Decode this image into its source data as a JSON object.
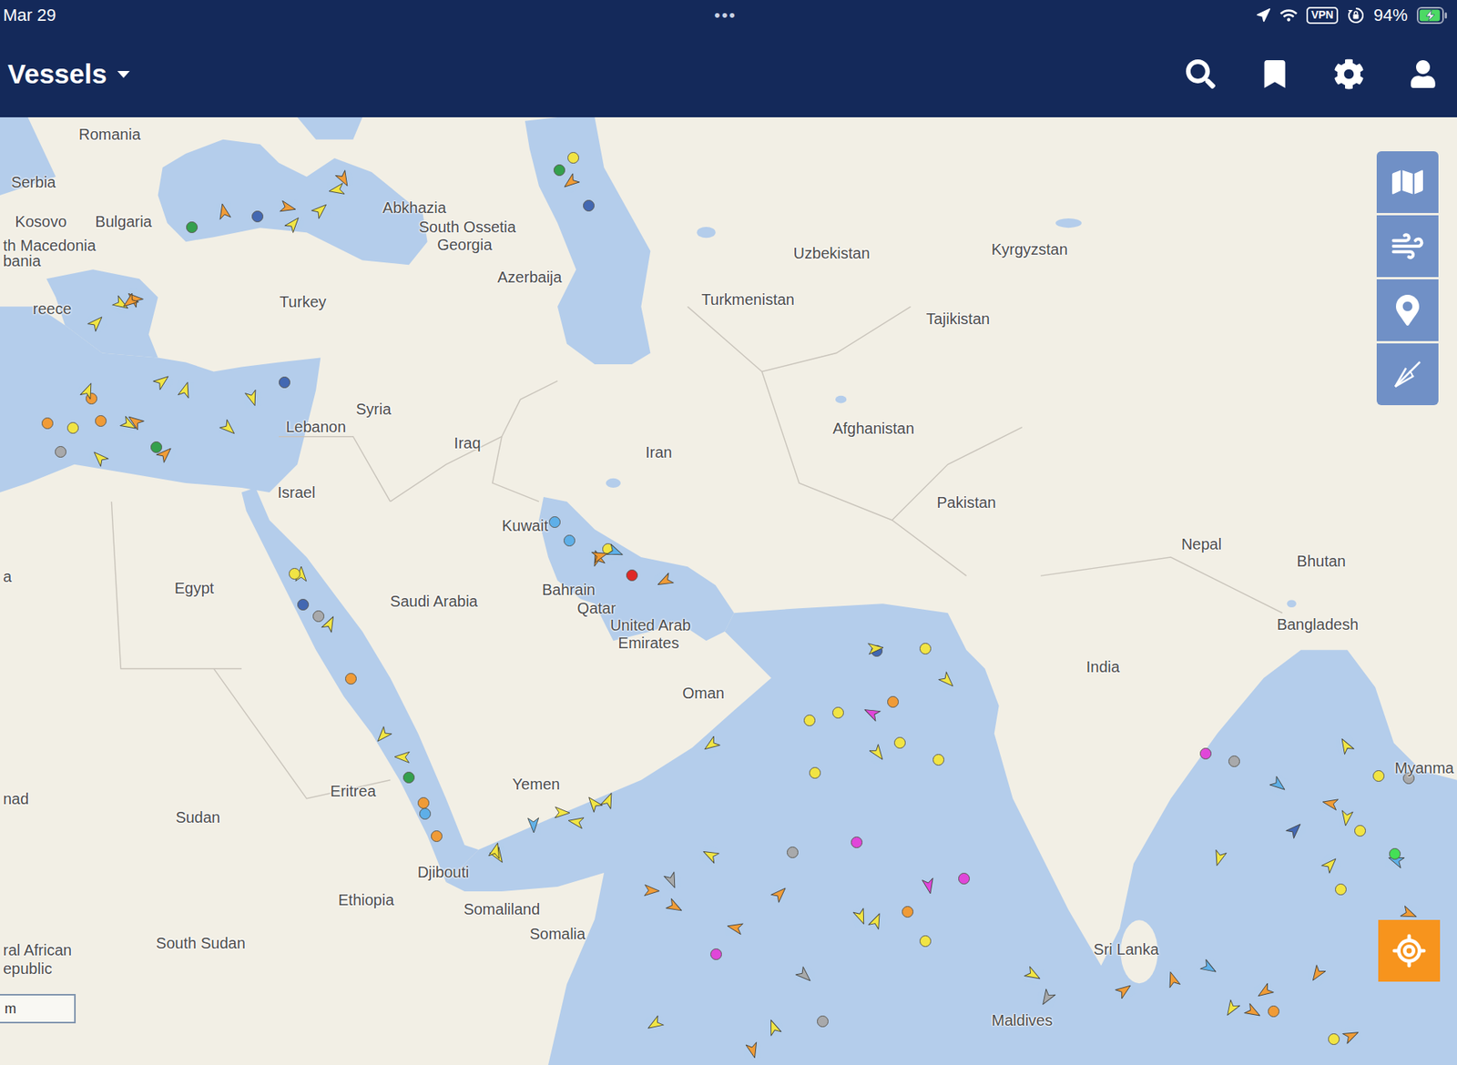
{
  "status_bar": {
    "date": "Mar 29",
    "handle": "•••",
    "vpn": "VPN",
    "battery": "94%",
    "battery_level": 0.94,
    "charging": true
  },
  "header": {
    "title": "Vessels"
  },
  "map": {
    "scale": "m",
    "labels": [
      "Romania",
      "Serbia",
      "Kosovo",
      "Bulgaria",
      "th Macedonia",
      "bania",
      "reece",
      "Turkey",
      "Abkhazia",
      "South Ossetia",
      "Georgia",
      "Azerbaija",
      "Uzbekistan",
      "Kyrgyzstan",
      "Turkmenistan",
      "Tajikistan",
      "Syria",
      "Lebanon",
      "Iraq",
      "Iran",
      "Afghanistan",
      "Pakistan",
      "Israel",
      "Egypt",
      "Saudi Arabia",
      "Kuwait",
      "Bahrain",
      "Qatar",
      "United Arab",
      "Emirates",
      "Oman",
      "Yemen",
      "Eritrea",
      "Sudan",
      "Djibouti",
      "Ethiopia",
      "Somaliland",
      "Somalia",
      "South Sudan",
      "ral African",
      "epublic",
      "nad",
      "a",
      "Nepal",
      "Bhutan",
      "India",
      "Bangladesh",
      "Myanma",
      "Sri Lanka",
      "Maldives"
    ],
    "vessels": [
      {
        "kind": "arrow",
        "color": "#f5e63c"
      },
      {
        "kind": "arrow",
        "color": "#f4992e"
      },
      {
        "kind": "dot",
        "color": "#f5e63c"
      },
      {
        "kind": "arrow",
        "color": "#f5e63c"
      },
      {
        "kind": "dot",
        "color": "#f4992e"
      },
      {
        "kind": "arrow",
        "color": "#5aaee8"
      },
      {
        "kind": "arrow",
        "color": "#f5e63c"
      },
      {
        "kind": "dot",
        "color": "#a8a8a8"
      },
      {
        "kind": "arrow",
        "color": "#f4992e"
      },
      {
        "kind": "dot",
        "color": "#f5e63c"
      },
      {
        "kind": "arrow",
        "color": "#f5e63c"
      },
      {
        "kind": "dot",
        "color": "#e33fd9"
      },
      {
        "kind": "arrow",
        "color": "#f4992e"
      },
      {
        "kind": "arrow",
        "color": "#f5e63c"
      },
      {
        "kind": "dot",
        "color": "#3e63b0"
      },
      {
        "kind": "arrow",
        "color": "#f5e63c"
      },
      {
        "kind": "dot",
        "color": "#2e9e45"
      },
      {
        "kind": "arrow",
        "color": "#f4992e"
      },
      {
        "kind": "arrow",
        "color": "#a8a8a8"
      },
      {
        "kind": "dot",
        "color": "#f5e63c"
      },
      {
        "kind": "arrow",
        "color": "#f5e63c"
      },
      {
        "kind": "arrow",
        "color": "#f4992e"
      },
      {
        "kind": "dot",
        "color": "#f4992e"
      },
      {
        "kind": "arrow",
        "color": "#f5e63c"
      },
      {
        "kind": "dot",
        "color": "#5aaee8"
      },
      {
        "kind": "arrow",
        "color": "#f5e63c"
      },
      {
        "kind": "arrow",
        "color": "#f4992e"
      },
      {
        "kind": "dot",
        "color": "#f5e63c"
      },
      {
        "kind": "arrow",
        "color": "#e33fd9"
      },
      {
        "kind": "dot",
        "color": "#a8a8a8"
      },
      {
        "kind": "arrow",
        "color": "#f5e63c"
      },
      {
        "kind": "dot",
        "color": "#3e63b0"
      },
      {
        "kind": "arrow",
        "color": "#f4992e"
      },
      {
        "kind": "arrow",
        "color": "#f5e63c"
      },
      {
        "kind": "dot",
        "color": "#f5e63c"
      },
      {
        "kind": "arrow",
        "color": "#5aaee8"
      },
      {
        "kind": "arrow",
        "color": "#f4992e"
      },
      {
        "kind": "dot",
        "color": "#f4992e"
      },
      {
        "kind": "arrow",
        "color": "#f5e63c"
      },
      {
        "kind": "dot",
        "color": "#e3211d"
      },
      {
        "kind": "arrow",
        "color": "#f4992e"
      },
      {
        "kind": "arrow",
        "color": "#f5e63c"
      },
      {
        "kind": "dot",
        "color": "#e33fd9"
      },
      {
        "kind": "arrow",
        "color": "#f5e63c"
      },
      {
        "kind": "dot",
        "color": "#2e9e45"
      },
      {
        "kind": "arrow",
        "color": "#f4992e"
      },
      {
        "kind": "arrow",
        "color": "#f5e63c"
      },
      {
        "kind": "dot",
        "color": "#f5e63c"
      },
      {
        "kind": "arrow",
        "color": "#a8a8a8"
      },
      {
        "kind": "dot",
        "color": "#3e63b0"
      },
      {
        "kind": "arrow",
        "color": "#f5e63c"
      },
      {
        "kind": "arrow",
        "color": "#f4992e"
      },
      {
        "kind": "dot",
        "color": "#f5e63c"
      },
      {
        "kind": "arrow",
        "color": "#5aaee8"
      },
      {
        "kind": "dot",
        "color": "#f4992e"
      },
      {
        "kind": "arrow",
        "color": "#f5e63c"
      },
      {
        "kind": "arrow",
        "color": "#f4992e"
      },
      {
        "kind": "dot",
        "color": "#a8a8a8"
      },
      {
        "kind": "arrow",
        "color": "#f5e63c"
      },
      {
        "kind": "dot",
        "color": "#3fe04f"
      },
      {
        "kind": "arrow",
        "color": "#f5e63c"
      },
      {
        "kind": "dot",
        "color": "#f4992e"
      },
      {
        "kind": "arrow",
        "color": "#f4992e"
      },
      {
        "kind": "arrow",
        "color": "#f5e63c"
      },
      {
        "kind": "dot",
        "color": "#f5e63c"
      },
      {
        "kind": "arrow",
        "color": "#3e63b0"
      },
      {
        "kind": "arrow",
        "color": "#f5e63c"
      },
      {
        "kind": "dot",
        "color": "#e33fd9"
      },
      {
        "kind": "arrow",
        "color": "#f4992e"
      },
      {
        "kind": "dot",
        "color": "#5aaee8"
      },
      {
        "kind": "arrow",
        "color": "#f4992e"
      },
      {
        "kind": "arrow",
        "color": "#f5e63c"
      },
      {
        "kind": "dot",
        "color": "#f5e63c"
      },
      {
        "kind": "arrow",
        "color": "#f5e63c"
      },
      {
        "kind": "dot",
        "color": "#f4992e"
      },
      {
        "kind": "arrow",
        "color": "#a8a8a8"
      },
      {
        "kind": "arrow",
        "color": "#f5e63c"
      },
      {
        "kind": "dot",
        "color": "#2e9e45"
      },
      {
        "kind": "arrow",
        "color": "#f4992e"
      },
      {
        "kind": "dot",
        "color": "#f5e63c"
      },
      {
        "kind": "arrow",
        "color": "#f5e63c"
      },
      {
        "kind": "dot",
        "color": "#3e63b0"
      },
      {
        "kind": "arrow",
        "color": "#f4992e"
      },
      {
        "kind": "arrow",
        "color": "#f5e63c"
      },
      {
        "kind": "dot",
        "color": "#a8a8a8"
      },
      {
        "kind": "arrow",
        "color": "#f5e63c"
      },
      {
        "kind": "arrow",
        "color": "#5aaee8"
      },
      {
        "kind": "dot",
        "color": "#f4992e"
      },
      {
        "kind": "arrow",
        "color": "#f5e63c"
      },
      {
        "kind": "dot",
        "color": "#f5e63c"
      },
      {
        "kind": "arrow",
        "color": "#f4992e"
      },
      {
        "kind": "arrow",
        "color": "#f5e63c"
      },
      {
        "kind": "dot",
        "color": "#e33fd9"
      },
      {
        "kind": "arrow",
        "color": "#f5e63c"
      },
      {
        "kind": "dot",
        "color": "#f5e63c"
      },
      {
        "kind": "arrow",
        "color": "#f4992e"
      },
      {
        "kind": "arrow",
        "color": "#f5e63c"
      },
      {
        "kind": "dot",
        "color": "#a8a8a8"
      },
      {
        "kind": "arrow",
        "color": "#f4992e"
      },
      {
        "kind": "dot",
        "color": "#5aaee8"
      },
      {
        "kind": "arrow",
        "color": "#f5e63c"
      },
      {
        "kind": "arrow",
        "color": "#f4992e"
      },
      {
        "kind": "dot",
        "color": "#f5e63c"
      },
      {
        "kind": "arrow",
        "color": "#f5e63c"
      },
      {
        "kind": "dot",
        "color": "#f4992e"
      },
      {
        "kind": "arrow",
        "color": "#5aaee8"
      },
      {
        "kind": "arrow",
        "color": "#f5e63c"
      },
      {
        "kind": "dot",
        "color": "#3e63b0"
      },
      {
        "kind": "arrow",
        "color": "#f4992e"
      },
      {
        "kind": "dot",
        "color": "#f5e63c"
      },
      {
        "kind": "arrow",
        "color": "#f5e63c"
      },
      {
        "kind": "dot",
        "color": "#2e9e45"
      },
      {
        "kind": "arrow",
        "color": "#f4992e"
      },
      {
        "kind": "arrow",
        "color": "#f5e63c"
      },
      {
        "kind": "dot",
        "color": "#f5e63c"
      },
      {
        "kind": "arrow",
        "color": "#e33fd9"
      },
      {
        "kind": "arrow",
        "color": "#f4992e"
      },
      {
        "kind": "dot",
        "color": "#f4992e"
      },
      {
        "kind": "arrow",
        "color": "#f5e63c"
      },
      {
        "kind": "dot",
        "color": "#a8a8a8"
      }
    ]
  }
}
